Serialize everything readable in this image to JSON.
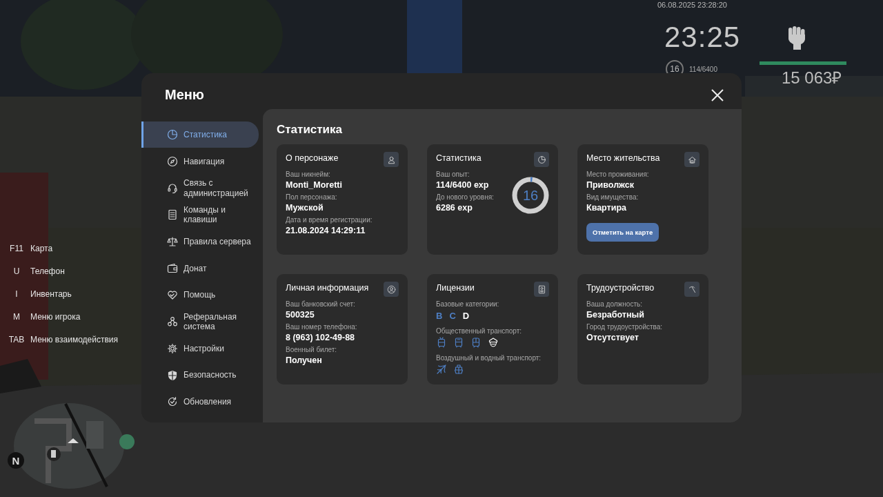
{
  "hud": {
    "datetime": "06.08.2025 23:28:20",
    "clock": "23:25",
    "level": "16",
    "exp": "114/6400",
    "health_bar": {
      "level": 1
    },
    "money": "15 063₽"
  },
  "keybinds": [
    {
      "key": "F11",
      "action": "Карта"
    },
    {
      "key": "U",
      "action": "Телефон"
    },
    {
      "key": "I",
      "action": "Инвентарь"
    },
    {
      "key": "M",
      "action": "Меню игрока"
    },
    {
      "key": "TAB",
      "action": "Меню взаимодействия"
    }
  ],
  "minimap": {
    "compass": "N"
  },
  "menu": {
    "title": "Меню",
    "sidebar": {
      "items": [
        {
          "label": "Статистика",
          "selected": true
        },
        {
          "label": "Навигация",
          "selected": false
        },
        {
          "label": "Связь с администрацией",
          "selected": false
        },
        {
          "label": "Команды и клавиши",
          "selected": false
        },
        {
          "label": "Правила сервера",
          "selected": false
        },
        {
          "label": "Донат",
          "selected": false
        },
        {
          "label": "Помощь",
          "selected": false
        },
        {
          "label": "Реферальная система",
          "selected": false
        },
        {
          "label": "Настройки",
          "selected": false
        },
        {
          "label": "Безопасность",
          "selected": false
        },
        {
          "label": "Обновления",
          "selected": false
        }
      ]
    },
    "heading": "Статистика",
    "cards": [
      {
        "kind": "fields",
        "title": "О персонаже",
        "fields": [
          {
            "label": "Ваш никнейм:",
            "value": "Monti_Moretti"
          },
          {
            "label": "Пол персонажа:",
            "value": "Мужской"
          },
          {
            "label": "Дата и время регистрации:",
            "value": "21.08.2024 14:29:11"
          }
        ]
      },
      {
        "kind": "level",
        "title": "Статистика",
        "fields": [
          {
            "label": "Ваш опыт:",
            "value": "114/6400 exp"
          },
          {
            "label": "До нового уровня:",
            "value": "6286 exp"
          }
        ],
        "ring": {
          "text": "16",
          "level": 0.018
        }
      },
      {
        "kind": "fields",
        "title": "Место жительства",
        "fields": [
          {
            "label": "Место проживания:",
            "value": "Приволжск"
          },
          {
            "label": "Вид имущества:",
            "value": "Квартира"
          }
        ],
        "button": "Отметить на карте"
      },
      {
        "kind": "fields",
        "title": "Личная информация",
        "fields": [
          {
            "label": "Ваш банковский счет:",
            "value": "500325"
          },
          {
            "label": "Ваш номер телефона:",
            "value": "8 (963) 102-49-88"
          },
          {
            "label": "Военный билет:",
            "value": "Получен"
          }
        ]
      },
      {
        "kind": "licenses",
        "title": "Лицензии",
        "categories_label": "Базовые категории:",
        "categories": [
          {
            "label": "B",
            "owned": true
          },
          {
            "label": "C",
            "owned": true
          },
          {
            "label": "D",
            "owned": false
          }
        ],
        "groups": [
          {
            "label": "Общественный транспорт:",
            "vehicles": [
              {
                "kind": "trolleybus",
                "owned": true
              },
              {
                "kind": "bus",
                "owned": true
              },
              {
                "kind": "tram",
                "owned": true
              },
              {
                "kind": "cap",
                "owned": false
              }
            ]
          },
          {
            "label": "Воздушный и водный транспорт:",
            "vehicles": [
              {
                "kind": "plane",
                "owned": true
              },
              {
                "kind": "boat",
                "owned": true
              }
            ]
          }
        ]
      },
      {
        "kind": "fields",
        "title": "Трудоустройство",
        "fields": [
          {
            "label": "Ваша должность:",
            "value": "Безработный"
          },
          {
            "label": "Город трудоустройства:",
            "value": "Отсутствует"
          }
        ]
      }
    ]
  }
}
